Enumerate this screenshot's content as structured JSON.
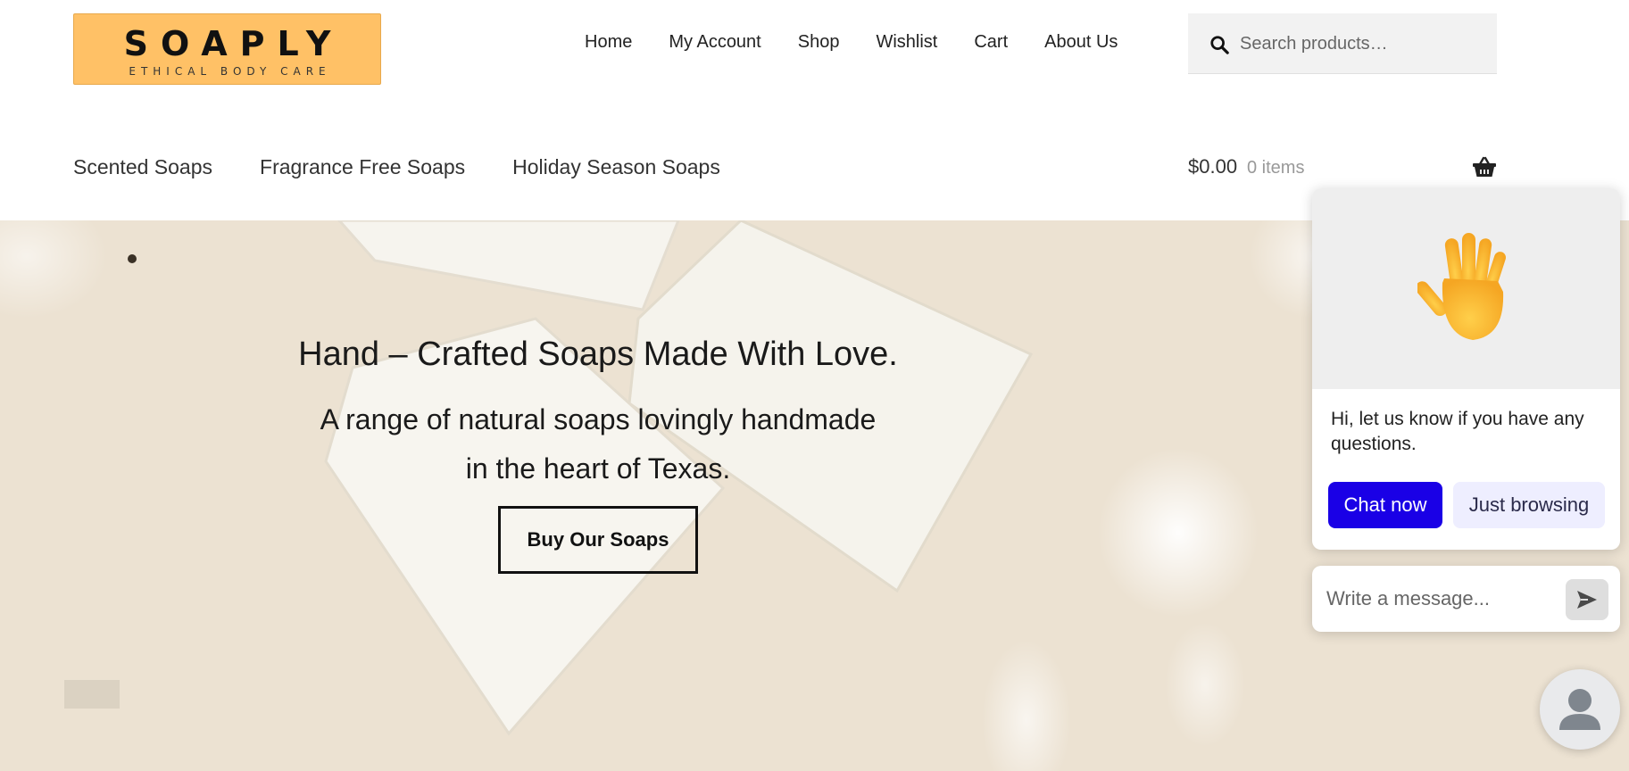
{
  "header": {
    "logo": {
      "title": "SOAPLY",
      "subtitle": "ETHICAL BODY CARE",
      "bg_color": "#ffc166"
    },
    "primary_nav": [
      {
        "label": "Home"
      },
      {
        "label": "My Account"
      },
      {
        "label": "Shop"
      },
      {
        "label": "Wishlist"
      },
      {
        "label": "Cart"
      },
      {
        "label": "About Us"
      }
    ],
    "search": {
      "placeholder": "Search products…",
      "icon": "search-icon"
    },
    "category_nav": [
      {
        "label": "Scented Soaps"
      },
      {
        "label": "Fragrance Free Soaps"
      },
      {
        "label": "Holiday Season Soaps"
      }
    ],
    "cart": {
      "amount": "$0.00",
      "count": "0 items",
      "icon": "basket-icon"
    }
  },
  "hero": {
    "title": "Hand – Crafted Soaps Made With Love.",
    "subtitle": "A range of natural soaps lovingly handmade in the heart of Texas.",
    "button_label": "Buy Our Soaps",
    "bg_color": "#ede3d3"
  },
  "chat": {
    "icon": "waving-hand-icon",
    "message": "Hi, let us know if you have any questions.",
    "chat_now_label": "Chat now",
    "just_browsing_label": "Just browsing",
    "input_placeholder": "Write a message...",
    "send_icon": "send-icon",
    "accent_color": "#1a00e6"
  },
  "launcher": {
    "icon": "user-avatar-icon"
  }
}
